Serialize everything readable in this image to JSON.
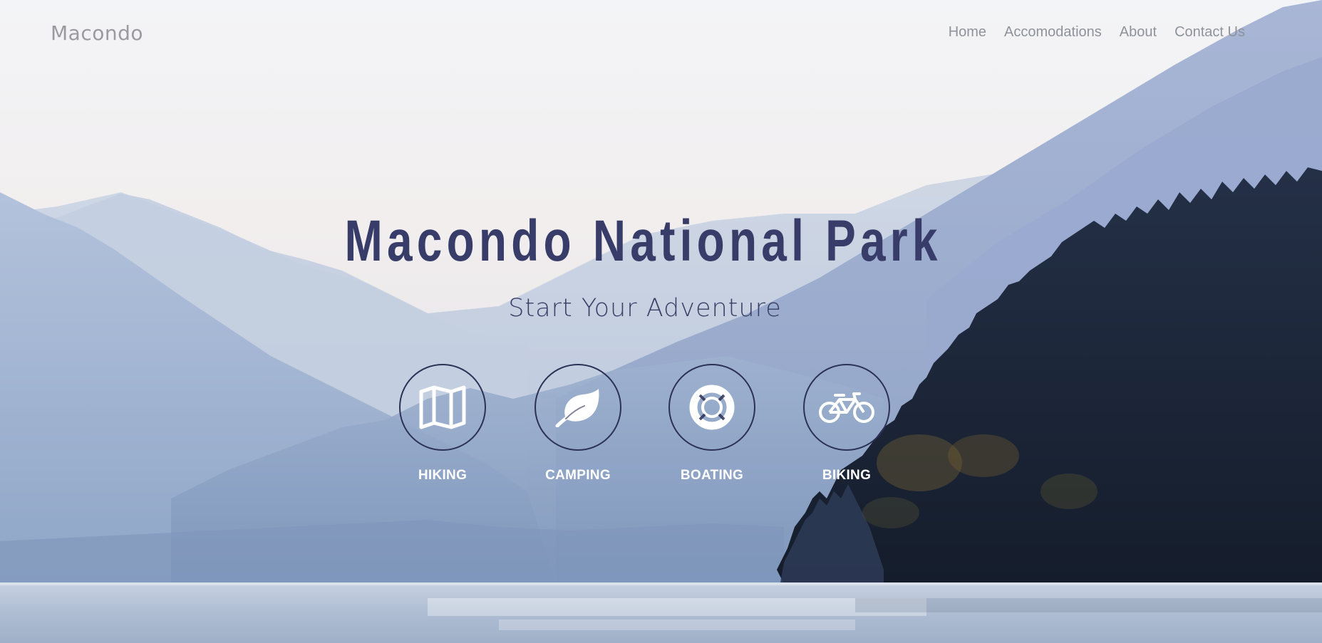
{
  "brand": {
    "name": "Macondo"
  },
  "nav": {
    "items": [
      {
        "label": "Home"
      },
      {
        "label": "Accomodations"
      },
      {
        "label": "About"
      },
      {
        "label": "Contact Us"
      }
    ]
  },
  "hero": {
    "title": "Macondo National Park",
    "subtitle": "Start Your Adventure"
  },
  "activities": [
    {
      "label": "HIKING",
      "icon": "map-icon"
    },
    {
      "label": "CAMPING",
      "icon": "leaf-icon"
    },
    {
      "label": "BOATING",
      "icon": "lifebuoy-icon"
    },
    {
      "label": "BIKING",
      "icon": "bicycle-icon"
    }
  ],
  "colors": {
    "title": "#373c68",
    "circle_border": "#2c3156",
    "icon": "#ffffff",
    "nav_text": "#8f9299"
  }
}
